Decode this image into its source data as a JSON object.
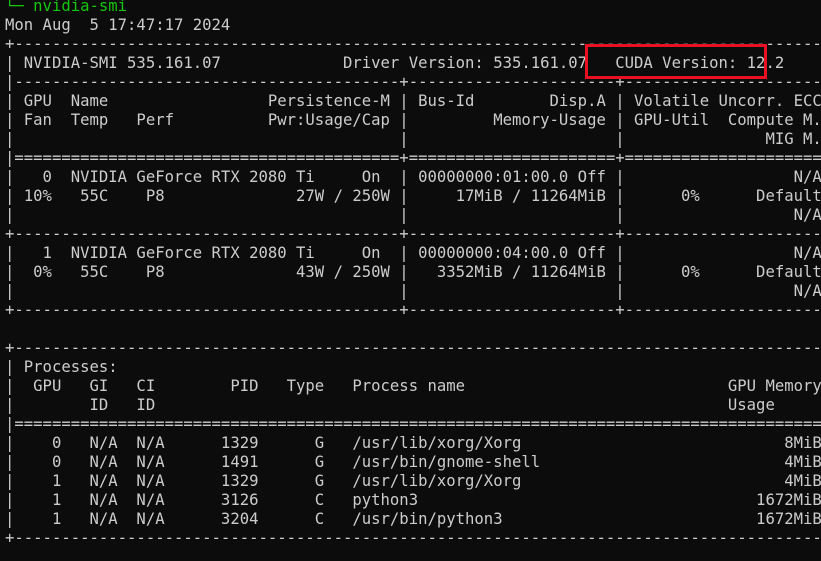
{
  "window": {
    "prompt_line": "└─ nvidia-smi",
    "date_line": "Mon Aug  5 17:47:17 2024"
  },
  "smi": {
    "top_border": "+---------------------------------------------------------------------------------------+",
    "header_line": "| NVIDIA-SMI 535.161.07             Driver Version: 535.161.07   CUDA Version: 12.2     |",
    "header_sep": "|-----------------------------------------+----------------------+----------------------+",
    "col_line_1": "| GPU  Name                 Persistence-M | Bus-Id        Disp.A | Volatile Uncorr. ECC |",
    "col_line_2": "| Fan  Temp   Perf          Pwr:Usage/Cap |         Memory-Usage | GPU-Util  Compute M. |",
    "col_line_3": "|                                         |                      |               MIG M. |",
    "cols_end_border": "|=========================================+======================+======================|",
    "gpu0_line_1": "|   0  NVIDIA GeForce RTX 2080 Ti     On  | 00000000:01:00.0 Off |                  N/A |",
    "gpu0_line_2": "| 10%   55C    P8              27W / 250W |     17MiB / 11264MiB |      0%      Default |",
    "gpu0_line_3": "|                                         |                      |                  N/A |",
    "gpu_separator": "+-----------------------------------------+----------------------+----------------------+",
    "gpu1_line_1": "|   1  NVIDIA GeForce RTX 2080 Ti     On  | 00000000:04:00.0 Off |                  N/A |",
    "gpu1_line_2": "|  0%   55C    P8              43W / 250W |   3352MiB / 11264MiB |      0%      Default |",
    "gpu1_line_3": "|                                         |                      |                  N/A |",
    "gpu_bottom_border": "+-----------------------------------------+----------------------+----------------------+",
    "blank_line": " ",
    "proc_top_border": "+---------------------------------------------------------------------------------------+",
    "proc_title": "| Processes:                                                                            |",
    "proc_cols_1": "|  GPU   GI   CI        PID   Type   Process name                            GPU Memory |",
    "proc_cols_2": "|        ID   ID                                                             Usage      |",
    "proc_cols_border": "|=======================================================================================|",
    "proc_rows": [
      "|    0   N/A  N/A      1329      G   /usr/lib/xorg/Xorg                            8MiB |",
      "|    0   N/A  N/A      1491      G   /usr/bin/gnome-shell                          4MiB |",
      "|    1   N/A  N/A      1329      G   /usr/lib/xorg/Xorg                            4MiB |",
      "|    1   N/A  N/A      3126      C   python3                                    1672MiB |",
      "|    1   N/A  N/A      3204      C   /usr/bin/python3                           1672MiB |"
    ],
    "proc_bottom_border": "+---------------------------------------------------------------------------------------+"
  },
  "colors": {
    "background": "#0c0c0c",
    "text": "#cccccc",
    "prompt": "#16c60c",
    "highlight": "#e81123"
  }
}
